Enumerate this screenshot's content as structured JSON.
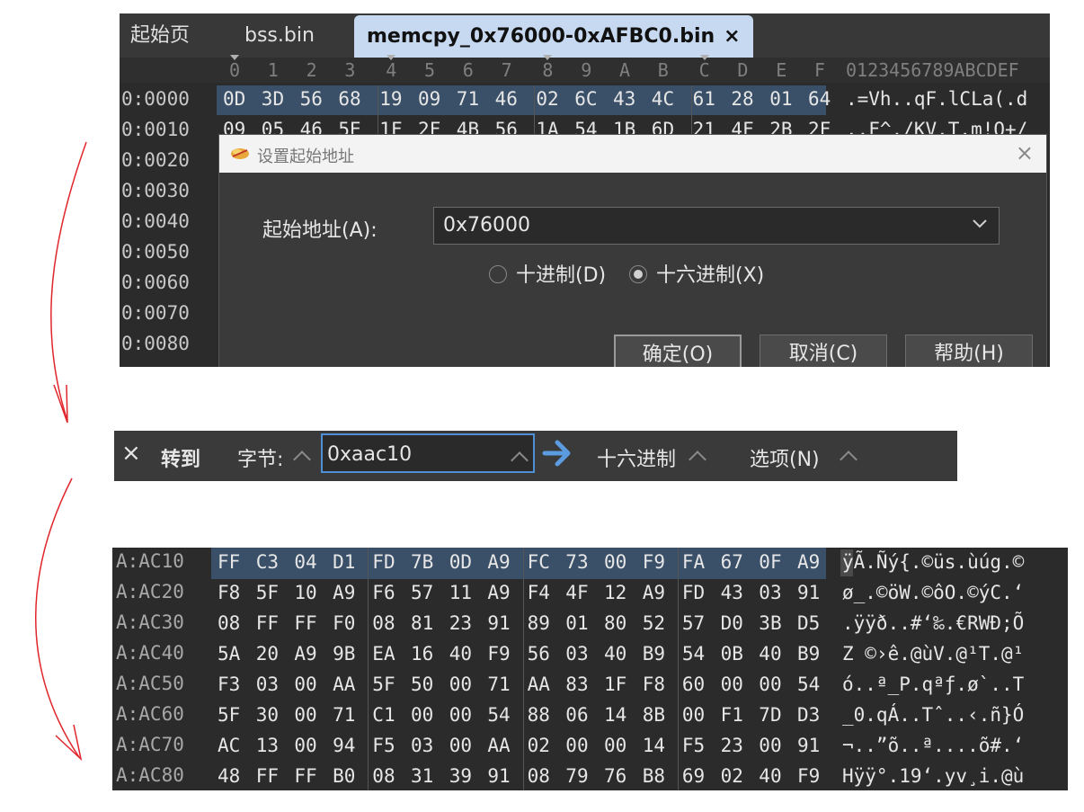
{
  "editor": {
    "tabs": [
      {
        "label": "起始页"
      },
      {
        "label": "bss.bin"
      },
      {
        "label": "memcpy_0x76000-0xAFBC0.bin",
        "close": "×"
      }
    ],
    "column_headers": [
      "0",
      "1",
      "2",
      "3",
      "4",
      "5",
      "6",
      "7",
      "8",
      "9",
      "A",
      "B",
      "C",
      "D",
      "E",
      "F"
    ],
    "ascii_header": "0123456789ABCDEF",
    "rows": [
      {
        "addr": "0:0000",
        "bytes": [
          "0D",
          "3D",
          "56",
          "68",
          "19",
          "09",
          "71",
          "46",
          "02",
          "6C",
          "43",
          "4C",
          "61",
          "28",
          "01",
          "64"
        ],
        "ascii": ".=Vh..qF.lCLa(.d"
      },
      {
        "addr": "0:0010",
        "bytes": [
          "09",
          "05",
          "46",
          "5E",
          "1F",
          "2F",
          "4B",
          "56",
          "1A",
          "54",
          "1B",
          "6D",
          "21",
          "4F",
          "2B",
          "2F"
        ],
        "ascii": "..F^./KV.T.m!O+/"
      },
      {
        "addr": "0:0020",
        "bytes": [],
        "ascii": ""
      },
      {
        "addr": "0:0030",
        "bytes": [],
        "ascii": ""
      },
      {
        "addr": "0:0040",
        "bytes": [],
        "ascii": ""
      },
      {
        "addr": "0:0050",
        "bytes": [],
        "ascii": ""
      },
      {
        "addr": "0:0060",
        "bytes": [],
        "ascii": ""
      },
      {
        "addr": "0:0070",
        "bytes": [],
        "ascii": ""
      },
      {
        "addr": "0:0080",
        "bytes": [],
        "ascii": ""
      }
    ]
  },
  "dialog": {
    "title": "设置起始地址",
    "close": "×",
    "address_label": "起始地址(A):",
    "address_value": "0x76000",
    "radio_decimal": "十进制(D)",
    "radio_hex": "十六进制(X)",
    "selected_radio": "hex",
    "ok": "确定(O)",
    "cancel": "取消(C)",
    "help": "帮助(H)"
  },
  "goto_bar": {
    "close": "×",
    "title": "转到",
    "bytes_label": "字节:",
    "input_value": "0xaac10",
    "mode": "十六进制",
    "options": "选项(N)"
  },
  "result": {
    "rows": [
      {
        "addr": "A:AC10",
        "bytes": [
          "FF",
          "C3",
          "04",
          "D1",
          "FD",
          "7B",
          "0D",
          "A9",
          "FC",
          "73",
          "00",
          "F9",
          "FA",
          "67",
          "0F",
          "A9"
        ],
        "ascii": "ÿÃ.Ñý{.©üs.ùúg.©"
      },
      {
        "addr": "A:AC20",
        "bytes": [
          "F8",
          "5F",
          "10",
          "A9",
          "F6",
          "57",
          "11",
          "A9",
          "F4",
          "4F",
          "12",
          "A9",
          "FD",
          "43",
          "03",
          "91"
        ],
        "ascii": "ø_.©öW.©ôO.©ýC.‘"
      },
      {
        "addr": "A:AC30",
        "bytes": [
          "08",
          "FF",
          "FF",
          "F0",
          "08",
          "81",
          "23",
          "91",
          "89",
          "01",
          "80",
          "52",
          "57",
          "D0",
          "3B",
          "D5"
        ],
        "ascii": ".ÿÿð..#‘‰.€RWÐ;Õ"
      },
      {
        "addr": "A:AC40",
        "bytes": [
          "5A",
          "20",
          "A9",
          "9B",
          "EA",
          "16",
          "40",
          "F9",
          "56",
          "03",
          "40",
          "B9",
          "54",
          "0B",
          "40",
          "B9"
        ],
        "ascii": "Z ©›ê.@ùV.@¹T.@¹"
      },
      {
        "addr": "A:AC50",
        "bytes": [
          "F3",
          "03",
          "00",
          "AA",
          "5F",
          "50",
          "00",
          "71",
          "AA",
          "83",
          "1F",
          "F8",
          "60",
          "00",
          "00",
          "54"
        ],
        "ascii": "ó..ª_P.qªƒ.ø`..T"
      },
      {
        "addr": "A:AC60",
        "bytes": [
          "5F",
          "30",
          "00",
          "71",
          "C1",
          "00",
          "00",
          "54",
          "88",
          "06",
          "14",
          "8B",
          "00",
          "F1",
          "7D",
          "D3"
        ],
        "ascii": "_0.qÁ..Tˆ..‹.ñ}Ó"
      },
      {
        "addr": "A:AC70",
        "bytes": [
          "AC",
          "13",
          "00",
          "94",
          "F5",
          "03",
          "00",
          "AA",
          "02",
          "00",
          "00",
          "14",
          "F5",
          "23",
          "00",
          "91"
        ],
        "ascii": "¬..”õ..ª....õ#.‘"
      },
      {
        "addr": "A:AC80",
        "bytes": [
          "48",
          "FF",
          "FF",
          "B0",
          "08",
          "31",
          "39",
          "91",
          "08",
          "79",
          "76",
          "B8",
          "69",
          "02",
          "40",
          "F9"
        ],
        "ascii": "Hÿÿ°.19‘.yv¸i.@ù"
      }
    ]
  },
  "colors": {
    "editor_bg": "#2b2b2b",
    "active_tab": "#c6d9f0",
    "row_highlight": "#3a4f68",
    "input_border": "#4f8fd6",
    "arrow": "#e0262b"
  }
}
